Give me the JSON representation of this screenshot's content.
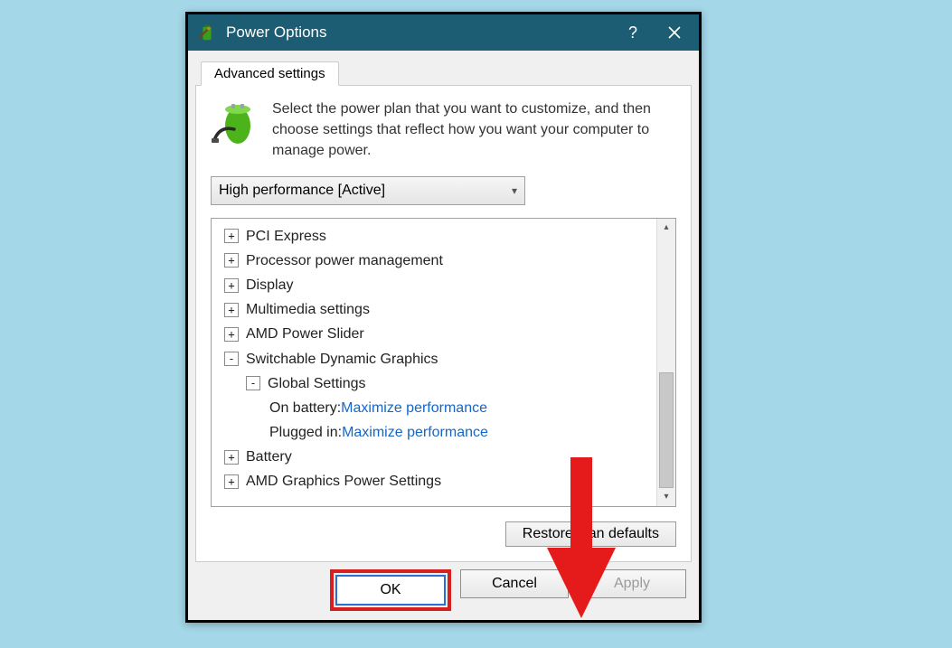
{
  "window": {
    "title": "Power Options"
  },
  "tab": {
    "label": "Advanced settings"
  },
  "intro": "Select the power plan that you want to customize, and then choose settings that reflect how you want your computer to manage power.",
  "plan": "High performance [Active]",
  "tree": {
    "pci": "PCI Express",
    "ppm": "Processor power management",
    "disp": "Display",
    "mm": "Multimedia settings",
    "amd_slider": "AMD Power Slider",
    "sdg": "Switchable Dynamic Graphics",
    "global": "Global Settings",
    "onbat_label": "On battery: ",
    "onbat_val": "Maximize performance",
    "plugged_label": "Plugged in: ",
    "plugged_val": "Maximize performance",
    "battery": "Battery",
    "amd_power": "AMD Graphics Power Settings"
  },
  "buttons": {
    "restore": "Restore plan defaults",
    "ok": "OK",
    "cancel": "Cancel",
    "apply": "Apply"
  }
}
